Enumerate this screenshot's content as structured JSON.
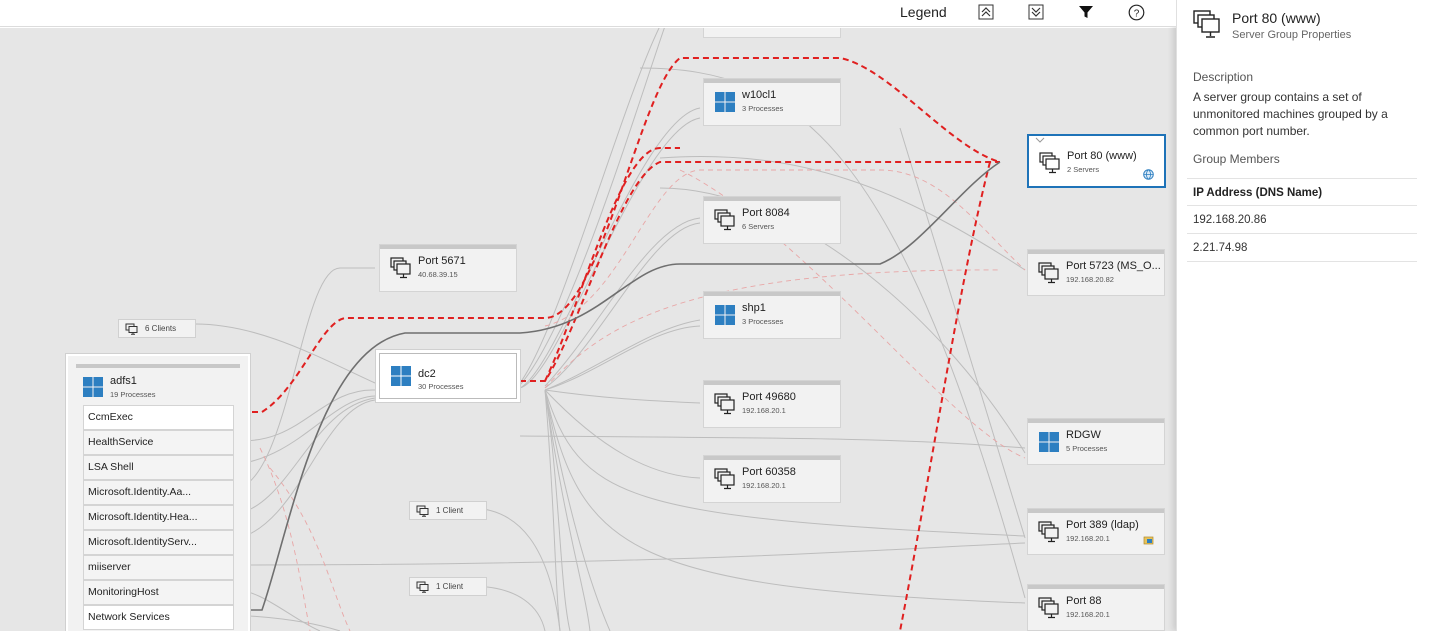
{
  "toolbar": {
    "legend_label": "Legend",
    "icons": [
      "expand-all-icon",
      "collapse-all-icon",
      "filter-icon",
      "help-icon"
    ]
  },
  "colors": {
    "selected_border": "#1e73b8",
    "failed_link": "#e02020",
    "windows_blue": "#2d7fc1",
    "canvas_bg": "#e6e6e6"
  },
  "nodes": {
    "w10cl1": {
      "title": "w10cl1",
      "sub": "3 Processes"
    },
    "port5671": {
      "title": "Port 5671",
      "sub": "40.68.39.15"
    },
    "port8084": {
      "title": "Port 8084",
      "sub": "6 Servers"
    },
    "shp1": {
      "title": "shp1",
      "sub": "3 Processes"
    },
    "dc2": {
      "title": "dc2",
      "sub": "30 Processes"
    },
    "port49680": {
      "title": "Port 49680",
      "sub": "192.168.20.1"
    },
    "port60358": {
      "title": "Port 60358",
      "sub": "192.168.20.1"
    },
    "port80": {
      "title": "Port 80 (www)",
      "sub": "2 Servers"
    },
    "port5723": {
      "title": "Port 5723 (MS_O...",
      "sub": "192.168.20.82"
    },
    "rdgw": {
      "title": "RDGW",
      "sub": "5 Processes"
    },
    "port389": {
      "title": "Port 389 (ldap)",
      "sub": "192.168.20.1"
    },
    "port88": {
      "title": "Port 88",
      "sub": "192.168.20.1"
    },
    "clients6": {
      "label": "6 Clients"
    },
    "client1a": {
      "label": "1 Client"
    },
    "client1b": {
      "label": "1 Client"
    }
  },
  "adfs1": {
    "title": "adfs1",
    "sub": "19 Processes",
    "processes": [
      "CcmExec",
      "HealthService",
      "LSA Shell",
      "Microsoft.Identity.Aa...",
      "Microsoft.Identity.Hea...",
      "Microsoft.IdentityServ...",
      "miiserver",
      "MonitoringHost",
      "Network Services"
    ]
  },
  "panel": {
    "title": "Port 80 (www)",
    "subtitle": "Server Group Properties",
    "description_heading": "Description",
    "description": "A server group contains a set of unmonitored machines grouped by a common port number.",
    "members_heading": "Group Members",
    "table_header": "IP Address (DNS Name)",
    "members": [
      "192.168.20.86",
      "2.21.74.98"
    ]
  }
}
